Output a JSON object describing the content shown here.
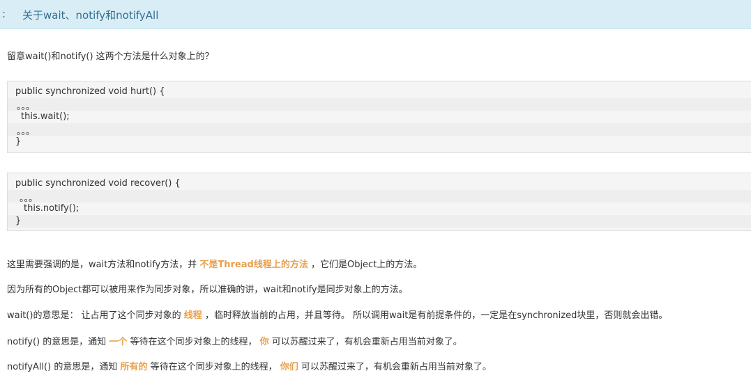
{
  "header": {
    "colon": ":",
    "title": "关于wait、notify和notifyAll"
  },
  "intro": "留意wait()和notify() 这两个方法是什么对象上的？",
  "code_block_1": {
    "lines": [
      "public synchronized void hurt() {",
      "。。。",
      "this.wait();",
      "。。。",
      "}"
    ]
  },
  "code_block_2": {
    "lines": [
      "public synchronized void recover() {",
      "。。。",
      "this.notify();",
      "}"
    ]
  },
  "paragraphs": {
    "p1": {
      "a": "这里需要强调的是，wait方法和notify方法，并 ",
      "hl": "不是Thread线程上的方法",
      "b": " ，它们是Object上的方法。"
    },
    "p2": "因为所有的Object都可以被用来作为同步对象，所以准确的讲，wait和notify是同步对象上的方法。",
    "p3": {
      "a": "wait()的意思是： 让占用了这个同步对象的 ",
      "hl": "线程",
      "b": " ，临时释放当前的占用，并且等待。 所以调用wait是有前提条件的，一定是在synchronized块里，否则就会出错。"
    },
    "p4": {
      "a": "notify() 的意思是，通知 ",
      "hl1": "一个",
      "b": " 等待在这个同步对象上的线程， ",
      "hl2": "你",
      "c": " 可以苏醒过来了，有机会重新占用当前对象了。"
    },
    "p5": {
      "a": "notifyAll() 的意思是，通知 ",
      "hl1": "所有的",
      "b": " 等待在这个同步对象上的线程， ",
      "hl2": "你们",
      "c": " 可以苏醒过来了，有机会重新占用当前对象了。"
    }
  }
}
